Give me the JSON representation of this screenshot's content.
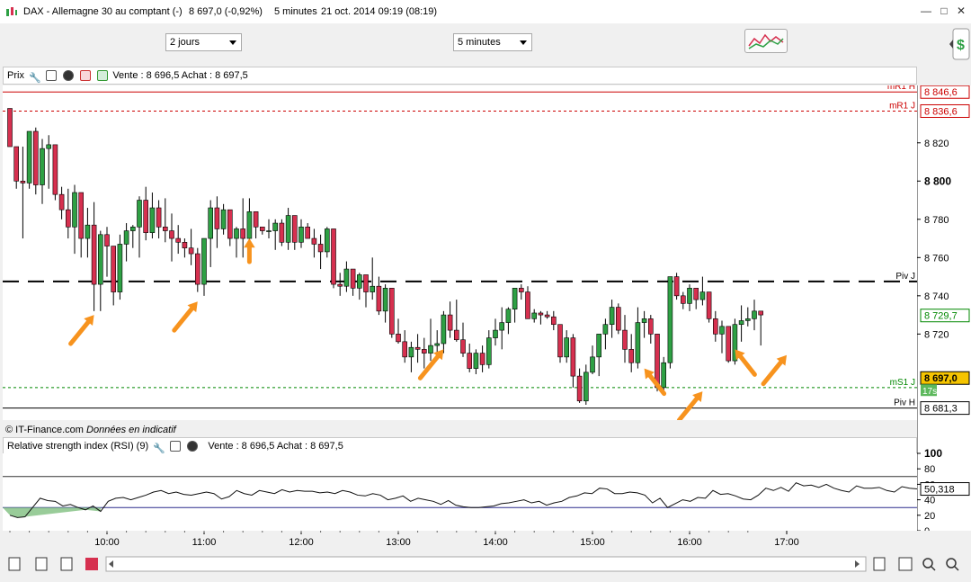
{
  "window": {
    "title": "DAX - Allemagne 30 au comptant (-)",
    "price": "8 697,0 (-0,92%)",
    "interval": "5 minutes",
    "datetime": "21 oct. 2014 09:19 (08:19)"
  },
  "toolbar": {
    "period_select": "2 jours",
    "interval_select": "5 minutes"
  },
  "price_panel": {
    "label": "Prix",
    "quote": "Vente : 8 696,5 Achat : 8 697,5",
    "source": "© IT-Finance.com",
    "source_note": "Données en indicatif",
    "level_labels": {
      "mr1h": "mR1 H",
      "mr1j": "mR1 J",
      "pivj": "Piv J",
      "ms1j": "mS1 J",
      "pivh": "Piv H"
    },
    "level_values": {
      "mr1h": "8 846,6",
      "mr1j": "8 836,6",
      "last": "8 729,7",
      "current": "8 697,0",
      "countdown": "17s",
      "pivh": "8 681,3"
    }
  },
  "rsi_panel": {
    "label": "Relative strength index (RSI) (9)",
    "quote": "Vente : 8 696,5 Achat : 8 697,5",
    "value": "50,318"
  },
  "colors": {
    "up": "#2ea044",
    "down": "#d6304f",
    "resistance": "#cc0000",
    "support": "#008800",
    "arrow": "#f7931e",
    "current_price_bg": "#f5c400",
    "rsi_fill": "#7fbf7f"
  },
  "chart_data": [
    {
      "type": "candlestick",
      "title": "Prix",
      "ylim": [
        8675,
        8850
      ],
      "ytick_labels": [
        "8 720",
        "8 740",
        "8 760",
        "8 780",
        "8 800",
        "8 820"
      ],
      "ytick_values": [
        8720,
        8740,
        8760,
        8780,
        8800,
        8820
      ],
      "major_tick": 8800,
      "xtick_labels": [
        "10:00",
        "11:00",
        "12:00",
        "13:00",
        "14:00",
        "15:00",
        "16:00",
        "17:00"
      ],
      "xtick_index": [
        15,
        30,
        45,
        60,
        75,
        90,
        105,
        120
      ],
      "levels": [
        {
          "name": "mR1 H",
          "value": 8846.6,
          "style": "solid",
          "color": "resistance"
        },
        {
          "name": "mR1 J",
          "value": 8836.6,
          "style": "dotted",
          "color": "resistance"
        },
        {
          "name": "Piv J",
          "value": 8747.5,
          "style": "dashed",
          "color": "#000000"
        },
        {
          "name": "mS1 J",
          "value": 8692.0,
          "style": "dotted",
          "color": "support"
        },
        {
          "name": "Piv H",
          "value": 8681.3,
          "style": "solid",
          "color": "#000000"
        }
      ],
      "arrows": [
        {
          "index": 13,
          "price": 8730,
          "dir": "up-right"
        },
        {
          "index": 29,
          "price": 8737,
          "dir": "up-right"
        },
        {
          "index": 37,
          "price": 8770,
          "dir": "up"
        },
        {
          "index": 67,
          "price": 8712,
          "dir": "up-right"
        },
        {
          "index": 98,
          "price": 8702,
          "dir": "up-left"
        },
        {
          "index": 107,
          "price": 8690,
          "dir": "up-right"
        },
        {
          "index": 112,
          "price": 8712,
          "dir": "up-left"
        },
        {
          "index": 120,
          "price": 8709,
          "dir": "up-right"
        }
      ],
      "ohlc": [
        [
          8838,
          8838,
          8818,
          8818
        ],
        [
          8818,
          8818,
          8796,
          8800
        ],
        [
          8800,
          8818,
          8770,
          8799
        ],
        [
          8799,
          8826,
          8796,
          8826
        ],
        [
          8826,
          8828,
          8793,
          8798
        ],
        [
          8798,
          8822,
          8788,
          8817
        ],
        [
          8817,
          8824,
          8796,
          8819
        ],
        [
          8819,
          8819,
          8790,
          8793
        ],
        [
          8793,
          8797,
          8780,
          8785
        ],
        [
          8785,
          8796,
          8770,
          8776
        ],
        [
          8776,
          8798,
          8762,
          8794
        ],
        [
          8794,
          8794,
          8760,
          8770
        ],
        [
          8770,
          8786,
          8760,
          8777
        ],
        [
          8777,
          8789,
          8732,
          8746
        ],
        [
          8746,
          8774,
          8732,
          8772
        ],
        [
          8772,
          8776,
          8750,
          8766
        ],
        [
          8766,
          8766,
          8735,
          8742
        ],
        [
          8742,
          8772,
          8738,
          8767
        ],
        [
          8767,
          8778,
          8758,
          8774
        ],
        [
          8774,
          8777,
          8765,
          8776
        ],
        [
          8776,
          8792,
          8760,
          8790
        ],
        [
          8790,
          8797,
          8769,
          8773
        ],
        [
          8773,
          8794,
          8770,
          8786
        ],
        [
          8786,
          8790,
          8770,
          8776
        ],
        [
          8776,
          8791,
          8768,
          8774
        ],
        [
          8774,
          8783,
          8758,
          8770
        ],
        [
          8770,
          8777,
          8762,
          8768
        ],
        [
          8768,
          8770,
          8760,
          8765
        ],
        [
          8765,
          8775,
          8756,
          8762
        ],
        [
          8762,
          8765,
          8742,
          8746
        ],
        [
          8746,
          8770,
          8740,
          8770
        ],
        [
          8770,
          8790,
          8755,
          8786
        ],
        [
          8786,
          8792,
          8765,
          8775
        ],
        [
          8775,
          8788,
          8772,
          8785
        ],
        [
          8785,
          8785,
          8766,
          8770
        ],
        [
          8770,
          8776,
          8760,
          8775
        ],
        [
          8775,
          8791,
          8760,
          8770
        ],
        [
          8770,
          8791,
          8762,
          8784
        ],
        [
          8784,
          8784,
          8770,
          8776
        ],
        [
          8776,
          8776,
          8772,
          8774
        ],
        [
          8774,
          8780,
          8770,
          8774
        ],
        [
          8774,
          8780,
          8764,
          8778
        ],
        [
          8778,
          8780,
          8766,
          8768
        ],
        [
          8768,
          8786,
          8764,
          8782
        ],
        [
          8782,
          8782,
          8764,
          8768
        ],
        [
          8768,
          8780,
          8765,
          8776
        ],
        [
          8776,
          8778,
          8770,
          8770
        ],
        [
          8770,
          8775,
          8760,
          8767
        ],
        [
          8767,
          8772,
          8754,
          8763
        ],
        [
          8763,
          8776,
          8760,
          8775
        ],
        [
          8775,
          8775,
          8744,
          8746
        ],
        [
          8746,
          8752,
          8740,
          8745
        ],
        [
          8745,
          8758,
          8742,
          8754
        ],
        [
          8754,
          8754,
          8740,
          8744
        ],
        [
          8744,
          8752,
          8738,
          8751
        ],
        [
          8751,
          8751,
          8734,
          8742
        ],
        [
          8742,
          8760,
          8738,
          8745
        ],
        [
          8745,
          8750,
          8730,
          8732
        ],
        [
          8732,
          8746,
          8726,
          8744
        ],
        [
          8744,
          8744,
          8718,
          8720
        ],
        [
          8720,
          8728,
          8715,
          8716
        ],
        [
          8716,
          8722,
          8705,
          8708
        ],
        [
          8708,
          8716,
          8700,
          8713
        ],
        [
          8713,
          8720,
          8705,
          8712
        ],
        [
          8712,
          8718,
          8702,
          8710
        ],
        [
          8710,
          8728,
          8706,
          8714
        ],
        [
          8714,
          8722,
          8708,
          8715
        ],
        [
          8715,
          8732,
          8710,
          8730
        ],
        [
          8730,
          8737,
          8718,
          8722
        ],
        [
          8722,
          8738,
          8716,
          8717
        ],
        [
          8717,
          8726,
          8708,
          8710
        ],
        [
          8710,
          8715,
          8700,
          8702
        ],
        [
          8702,
          8712,
          8699,
          8710
        ],
        [
          8710,
          8714,
          8700,
          8704
        ],
        [
          8704,
          8722,
          8702,
          8718
        ],
        [
          8718,
          8728,
          8714,
          8722
        ],
        [
          8722,
          8734,
          8712,
          8726
        ],
        [
          8726,
          8734,
          8720,
          8733
        ],
        [
          8733,
          8744,
          8726,
          8744
        ],
        [
          8744,
          8746,
          8738,
          8742
        ],
        [
          8742,
          8745,
          8730,
          8728
        ],
        [
          8728,
          8733,
          8726,
          8731
        ],
        [
          8731,
          8732,
          8725,
          8730
        ],
        [
          8730,
          8732,
          8728,
          8729
        ],
        [
          8729,
          8732,
          8722,
          8725
        ],
        [
          8725,
          8725,
          8705,
          8708
        ],
        [
          8708,
          8722,
          8705,
          8718
        ],
        [
          8718,
          8720,
          8692,
          8698
        ],
        [
          8698,
          8702,
          8684,
          8685
        ],
        [
          8685,
          8704,
          8683,
          8700
        ],
        [
          8700,
          8714,
          8699,
          8708
        ],
        [
          8708,
          8718,
          8698,
          8720
        ],
        [
          8720,
          8728,
          8712,
          8725
        ],
        [
          8725,
          8738,
          8718,
          8734
        ],
        [
          8734,
          8736,
          8720,
          8722
        ],
        [
          8722,
          8730,
          8705,
          8712
        ],
        [
          8712,
          8720,
          8700,
          8705
        ],
        [
          8705,
          8734,
          8702,
          8726
        ],
        [
          8726,
          8732,
          8718,
          8728
        ],
        [
          8728,
          8730,
          8715,
          8720
        ],
        [
          8720,
          8720,
          8690,
          8692
        ],
        [
          8692,
          8708,
          8688,
          8705
        ],
        [
          8705,
          8750,
          8702,
          8750
        ],
        [
          8750,
          8752,
          8738,
          8740
        ],
        [
          8740,
          8742,
          8733,
          8736
        ],
        [
          8736,
          8746,
          8732,
          8744
        ],
        [
          8744,
          8744,
          8733,
          8738
        ],
        [
          8738,
          8750,
          8735,
          8742
        ],
        [
          8742,
          8742,
          8726,
          8728
        ],
        [
          8728,
          8732,
          8716,
          8720
        ],
        [
          8720,
          8727,
          8710,
          8724
        ],
        [
          8724,
          8724,
          8705,
          8706
        ],
        [
          8706,
          8728,
          8704,
          8725
        ],
        [
          8725,
          8735,
          8716,
          8727
        ],
        [
          8727,
          8734,
          8724,
          8728
        ],
        [
          8728,
          8738,
          8722,
          8732
        ],
        [
          8732,
          8732,
          8714,
          8730
        ]
      ]
    },
    {
      "type": "line",
      "title": "Relative strength index (RSI) (9)",
      "ylim": [
        0,
        100
      ],
      "ytick_labels": [
        "100",
        "80",
        "60",
        "40",
        "20",
        "0"
      ],
      "ytick_values": [
        100,
        80,
        60,
        40,
        20,
        0
      ],
      "levels": [
        70,
        30
      ],
      "values": [
        20,
        17,
        18,
        30,
        42,
        39,
        38,
        32,
        34,
        30,
        27,
        32,
        25,
        38,
        42,
        43,
        40,
        43,
        46,
        50,
        52,
        48,
        50,
        47,
        46,
        48,
        50,
        48,
        41,
        44,
        52,
        48,
        46,
        52,
        50,
        48,
        53,
        50,
        52,
        51,
        51,
        49,
        50,
        48,
        52,
        50,
        46,
        45,
        48,
        46,
        40,
        42,
        45,
        38,
        42,
        40,
        38,
        34,
        39,
        33,
        31,
        30,
        30,
        31,
        32,
        35,
        36,
        38,
        40,
        36,
        38,
        33,
        36,
        38,
        43,
        45,
        49,
        48,
        55,
        54,
        48,
        48,
        50,
        49,
        46,
        36,
        42,
        30,
        35,
        40,
        38,
        43,
        42,
        52,
        47,
        48,
        45,
        41,
        40,
        46,
        55,
        52,
        56,
        51,
        62,
        58,
        59,
        56,
        60,
        55,
        52,
        50,
        58,
        55,
        55,
        56,
        52,
        50,
        57,
        55,
        54
      ]
    }
  ]
}
